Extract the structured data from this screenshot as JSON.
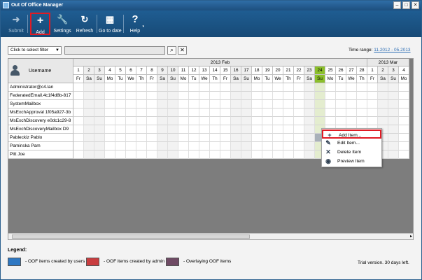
{
  "window": {
    "title": "Out Of Office Manager",
    "controls": [
      "–",
      "□",
      "✕"
    ]
  },
  "toolbar": {
    "buttons": [
      {
        "label": "Submit",
        "icon": "submit-icon",
        "enabled": false
      },
      {
        "label": "Add",
        "icon": "plus-icon",
        "enabled": true,
        "highlighted": true
      },
      {
        "label": "Settings",
        "icon": "wrench-icon",
        "enabled": true
      },
      {
        "label": "Refresh",
        "icon": "refresh-icon",
        "enabled": true
      },
      {
        "label": "Go to date",
        "icon": "calendar-icon",
        "enabled": true
      },
      {
        "label": "Help",
        "icon": "question-icon",
        "enabled": true
      }
    ]
  },
  "filter": {
    "select_value": "Click to select filter",
    "input_value": "",
    "search_icon": "search-icon",
    "clear_icon": "clear-icon"
  },
  "time_range": {
    "label": "Time range:",
    "value": "11.2012 - 05.2013"
  },
  "grid": {
    "user_header": "Username",
    "months": [
      {
        "label": "2013 Feb"
      },
      {
        "label": "2013 Mar"
      }
    ],
    "days": [
      {
        "d": "1",
        "w": "Fr"
      },
      {
        "d": "2",
        "w": "Sa"
      },
      {
        "d": "3",
        "w": "Su"
      },
      {
        "d": "4",
        "w": "Mo"
      },
      {
        "d": "5",
        "w": "Tu"
      },
      {
        "d": "6",
        "w": "We"
      },
      {
        "d": "7",
        "w": "Th"
      },
      {
        "d": "8",
        "w": "Fr"
      },
      {
        "d": "9",
        "w": "Sa"
      },
      {
        "d": "10",
        "w": "Su"
      },
      {
        "d": "11",
        "w": "Mo"
      },
      {
        "d": "12",
        "w": "Tu"
      },
      {
        "d": "13",
        "w": "We"
      },
      {
        "d": "14",
        "w": "Th"
      },
      {
        "d": "15",
        "w": "Fr"
      },
      {
        "d": "16",
        "w": "Sa"
      },
      {
        "d": "17",
        "w": "Su"
      },
      {
        "d": "18",
        "w": "Mo"
      },
      {
        "d": "19",
        "w": "Tu"
      },
      {
        "d": "20",
        "w": "We"
      },
      {
        "d": "21",
        "w": "Th"
      },
      {
        "d": "22",
        "w": "Fr"
      },
      {
        "d": "23",
        "w": "Sa"
      },
      {
        "d": "24",
        "w": "Su",
        "today": true
      },
      {
        "d": "25",
        "w": "Mo"
      },
      {
        "d": "26",
        "w": "Tu"
      },
      {
        "d": "27",
        "w": "We"
      },
      {
        "d": "28",
        "w": "Th"
      },
      {
        "d": "1",
        "w": "Fr"
      },
      {
        "d": "2",
        "w": "Sa"
      },
      {
        "d": "3",
        "w": "Su"
      },
      {
        "d": "4",
        "w": "Mo"
      }
    ],
    "users": [
      "Administrator@c4.lan",
      "FederatedEmail.4c1f4d8b-817",
      "SystemMailbox",
      "MsExchApproval 1f05a927-3b",
      "MsExchDiscovery e0dc1c29-8",
      "MsExchDiscoveryMailbox D9",
      "Pableckiz Pablo",
      "Paminska Pam",
      "Pitt Joe"
    ],
    "selected_row": 6,
    "selected_day": 23
  },
  "context_menu": {
    "items": [
      {
        "label": "Add Item...",
        "icon": "plus-icon",
        "highlighted": true
      },
      {
        "label": "Edit Item...",
        "icon": "pencil-icon"
      },
      {
        "label": "Delete Item",
        "icon": "delete-icon"
      },
      {
        "label": "Preview Item",
        "icon": "eye-icon"
      }
    ]
  },
  "legend": {
    "title": "Legend:",
    "items": [
      {
        "label": "- OOF items created by users",
        "color": "#2e78c3"
      },
      {
        "label": "- OOF items created by admin",
        "color": "#c93d3f"
      },
      {
        "label": "- Overlaying OOF items",
        "color": "#6f4a64"
      }
    ]
  },
  "trial_text": "Trial version. 30 days left."
}
